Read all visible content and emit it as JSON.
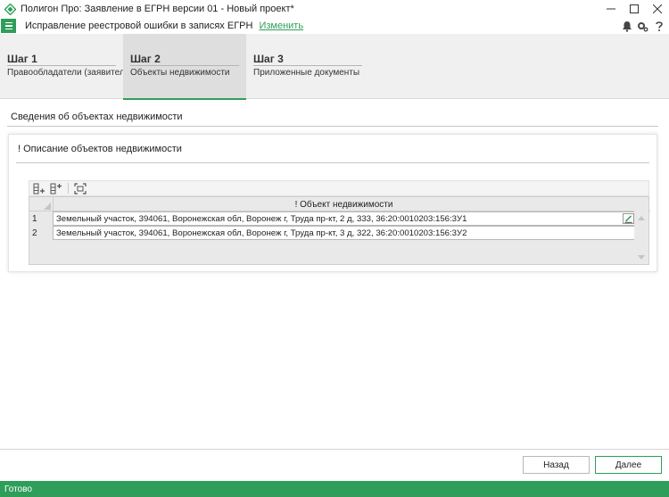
{
  "window": {
    "title": "Полигон Про: Заявление в ЕГРН версии 01 - Новый проект*"
  },
  "subbar": {
    "document_type": "Исправление реестровой ошибки в записях ЕГРН",
    "change_link": "Изменить"
  },
  "steps": [
    {
      "title": "Шаг 1",
      "subtitle": "Правообладатели (заявители)"
    },
    {
      "title": "Шаг 2",
      "subtitle": "Объекты недвижимости",
      "active": true
    },
    {
      "title": "Шаг 3",
      "subtitle": "Приложенные документы"
    }
  ],
  "section": {
    "title": "Сведения об объектах недвижимости"
  },
  "panel": {
    "title": "! Описание объектов недвижимости"
  },
  "table": {
    "column_header": "! Объект недвижимости",
    "rows": [
      {
        "num": "1",
        "value": "Земельный участок, 394061, Воронежская обл, Воронеж г, Труда пр-кт, 2 д, 333, 36:20:0010203:156:3У1"
      },
      {
        "num": "2",
        "value": "Земельный участок, 394061, Воронежская обл, Воронеж г, Труда пр-кт, 3 д, 322, 36:20:0010203:156:3У2"
      }
    ]
  },
  "buttons": {
    "back": "Назад",
    "next": "Далее"
  },
  "status": {
    "text": "Готово"
  },
  "colors": {
    "accent": "#2f9e5a"
  }
}
